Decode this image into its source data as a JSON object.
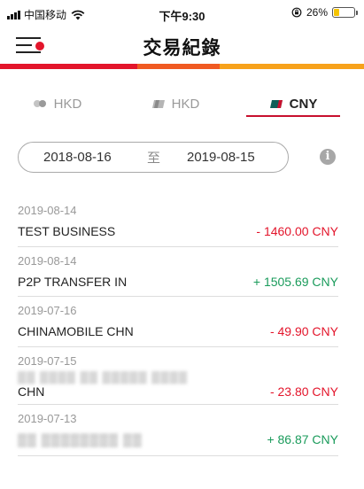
{
  "status_bar": {
    "carrier": "中国移动",
    "time": "下午9:30",
    "battery": "26%",
    "battery_level": 0.26,
    "battery_color": "#f5c400"
  },
  "header": {
    "title": "交易紀錄",
    "menu_icon": "menu-icon",
    "accent_dot_color": "#e3152b"
  },
  "color_strip": [
    "#e3152b",
    "#f05a22",
    "#f7a21b"
  ],
  "tabs": [
    {
      "label": "HKD",
      "icon": "gray-card-icon",
      "active": false
    },
    {
      "label": "HKD",
      "icon": "silver-card-icon",
      "active": false
    },
    {
      "label": "CNY",
      "icon": "cny-card-icon",
      "active": true
    }
  ],
  "date_filter": {
    "start": "2018-08-16",
    "separator": "至",
    "end": "2019-08-15",
    "info_icon": "info-icon"
  },
  "transactions": [
    {
      "date": "2019-08-14",
      "description": "TEST BUSINESS",
      "amount": "- 1460.00 CNY",
      "type": "debit"
    },
    {
      "date": "2019-08-14",
      "description": "P2P TRANSFER IN",
      "amount": "+ 1505.69 CNY",
      "type": "credit"
    },
    {
      "date": "2019-07-16",
      "description": "CHINAMOBILE CHN",
      "amount": "- 49.90 CNY",
      "type": "debit"
    },
    {
      "date": "2019-07-15",
      "description": "CHN",
      "amount": "- 23.80 CNY",
      "type": "debit"
    },
    {
      "date": "2019-07-13",
      "description": "",
      "amount": "+ 86.87 CNY",
      "type": "credit"
    }
  ],
  "colors": {
    "debit": "#e3152b",
    "credit": "#1a9b5b",
    "active_tab_underline": "#c8102e"
  }
}
